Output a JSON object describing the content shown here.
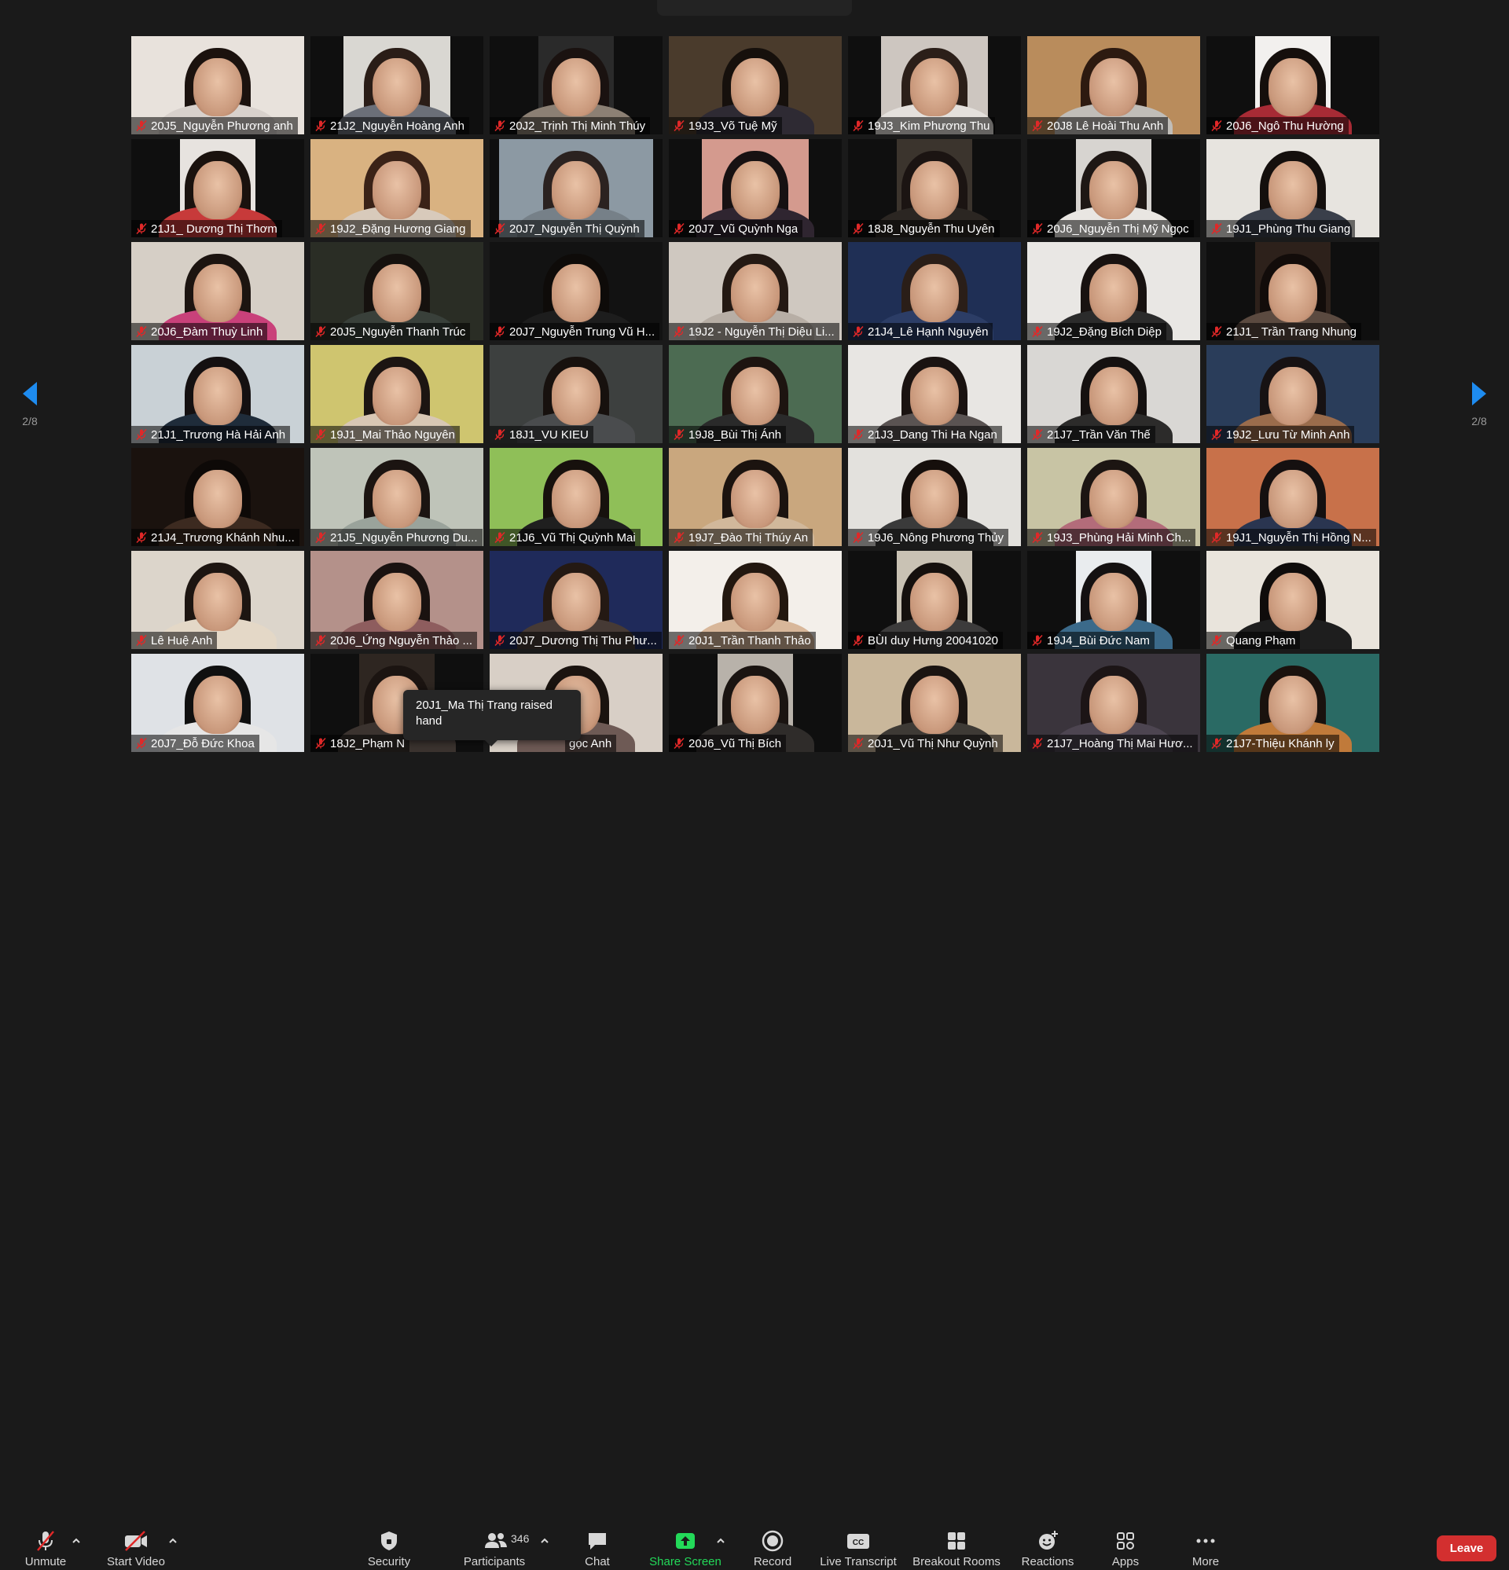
{
  "navigation": {
    "page_left": "2/8",
    "page_right": "2/8"
  },
  "participants": [
    {
      "name": "20J5_Nguyễn Phương anh",
      "bg": "#e8e2dc",
      "hair": "#1b120e",
      "shirt": "#d8d1cc",
      "fit": "full"
    },
    {
      "name": "21J2_Nguyễn Hoàng Anh",
      "bg": "#d9d7d2",
      "hair": "#2a1d17",
      "shirt": "#6b6f78",
      "fit": "mid"
    },
    {
      "name": "20J2_Trịnh Thị Minh Thúy",
      "bg": "#2a2a2a",
      "hair": "#1a1210",
      "shirt": "#8c8074",
      "fit": "narrow"
    },
    {
      "name": "19J3_Võ Tuệ Mỹ",
      "bg": "#4a3b2c",
      "hair": "#16100c",
      "shirt": "#2e2a33",
      "fit": "full"
    },
    {
      "name": "19J3_Kim Phương Thu",
      "bg": "#cdc6c0",
      "hair": "#2b1f19",
      "shirt": "#e4e0dc",
      "fit": "mid"
    },
    {
      "name": "20J8 Lê Hoài Thu Anh",
      "bg": "#b98c5c",
      "hair": "#2d1a10",
      "shirt": "#c0bdb8",
      "fit": "full"
    },
    {
      "name": "20J6_Ngô Thu Hường",
      "bg": "#f2f0ee",
      "hair": "#150f0c",
      "shirt": "#a72b35",
      "fit": "narrow"
    },
    {
      "name": "21J1_ Dương Thị Thơm",
      "bg": "#e7e3df",
      "hair": "#1a120e",
      "shirt": "#c73a3a",
      "fit": "narrow"
    },
    {
      "name": "19J2_Đặng Hương Giang",
      "bg": "#d9b281",
      "hair": "#3a2217",
      "shirt": "#d8cabb",
      "fit": "full"
    },
    {
      "name": "20J7_Nguyễn Thị Quỳnh",
      "bg": "#8c99a3",
      "hair": "#2b2220",
      "shirt": "#768088",
      "fit": "wide"
    },
    {
      "name": "20J7_Vũ Quỳnh Nga",
      "bg": "#d49a8e",
      "hair": "#171112",
      "shirt": "#2f2530",
      "fit": "mid"
    },
    {
      "name": "18J8_Nguyễn Thu Uyên",
      "bg": "#3b342d",
      "hair": "#1b1412",
      "shirt": "#2b2622",
      "fit": "narrow"
    },
    {
      "name": "20J6_Nguyễn Thị Mỹ Ngọc",
      "bg": "#d7d4d0",
      "hair": "#1e1714",
      "shirt": "#e9e6e2",
      "fit": "narrow"
    },
    {
      "name": "19J1_Phùng Thu Giang",
      "bg": "#e7e4df",
      "hair": "#140f0d",
      "shirt": "#3a3f4a",
      "fit": "full"
    },
    {
      "name": "20J6_Đàm Thuỳ Linh",
      "bg": "#d6cfc6",
      "hair": "#1c1410",
      "shirt": "#c9417a",
      "fit": "full"
    },
    {
      "name": "20J5_Nguyễn Thanh Trúc",
      "bg": "#2a2d25",
      "hair": "#15110e",
      "shirt": "#39403a",
      "fit": "full"
    },
    {
      "name": "20J7_Nguyễn Trung Vũ H...",
      "bg": "#121212",
      "hair": "#0e0b09",
      "shirt": "#1d1d1d",
      "fit": "full"
    },
    {
      "name": "19J2 - Nguyễn Thị Diệu Li...",
      "bg": "#cfc8c0",
      "hair": "#241913",
      "shirt": "#b7aea5",
      "fit": "full"
    },
    {
      "name": "21J4_Lê Hạnh Nguyên",
      "bg": "#1f2f55",
      "hair": "#2a1e18",
      "shirt": "#2c3d66",
      "fit": "full"
    },
    {
      "name": "19J2_Đặng Bích Diệp",
      "bg": "#e9e7e4",
      "hair": "#181210",
      "shirt": "#2b2b2b",
      "fit": "full"
    },
    {
      "name": "21J1_ Trần Trang Nhung",
      "bg": "#2d211b",
      "hair": "#120c0a",
      "shirt": "#5b4a40",
      "fit": "narrow"
    },
    {
      "name": "21J1_Trương Hà Hải Anh",
      "bg": "#c9d1d6",
      "hair": "#141011",
      "shirt": "#1f2c3a",
      "fit": "full"
    },
    {
      "name": "19J1_Mai Thảo Nguyên",
      "bg": "#cfc56f",
      "hair": "#1c1512",
      "shirt": "#d8c7b4",
      "fit": "full"
    },
    {
      "name": "18J1_VU KIEU",
      "bg": "#3d403f",
      "hair": "#17110e",
      "shirt": "#4a4c4e",
      "fit": "full"
    },
    {
      "name": "19J8_Bùi Thị Ánh",
      "bg": "#4c6b52",
      "hair": "#1d1410",
      "shirt": "#2a2a2a",
      "fit": "full"
    },
    {
      "name": "21J3_Dang Thi Ha Ngan",
      "bg": "#e8e6e3",
      "hair": "#1a1311",
      "shirt": "#5a5352",
      "fit": "full"
    },
    {
      "name": "21J7_Trần Văn Thế",
      "bg": "#d9d7d4",
      "hair": "#151110",
      "shirt": "#2c2b2a",
      "fit": "full"
    },
    {
      "name": "19J2_Lưu Từ Minh Anh",
      "bg": "#2a3d5a",
      "hair": "#171213",
      "shirt": "#9a6c4c",
      "fit": "full"
    },
    {
      "name": "21J4_Trương Khánh Nhu...",
      "bg": "#1a120e",
      "hair": "#0d0907",
      "shirt": "#3c2a20",
      "fit": "full"
    },
    {
      "name": "21J5_Nguyễn Phương Du...",
      "bg": "#bfc4b9",
      "hair": "#1b1411",
      "shirt": "#9aa39b",
      "fit": "full"
    },
    {
      "name": "21J6_Vũ Thị Quỳnh Mai",
      "bg": "#8fbf58",
      "hair": "#17110d",
      "shirt": "#1f1f1f",
      "fit": "full"
    },
    {
      "name": "19J7_Đào Thị Thúy An",
      "bg": "#c9a77e",
      "hair": "#1b130f",
      "shirt": "#d1b89b",
      "fit": "full"
    },
    {
      "name": "19J6_Nông Phương Thủy",
      "bg": "#e3e1dd",
      "hair": "#160f0c",
      "shirt": "#3a3a3a",
      "fit": "full"
    },
    {
      "name": "19J3_Phùng Hải Minh Ch...",
      "bg": "#c8c4a4",
      "hair": "#1c1512",
      "shirt": "#b36c7a",
      "fit": "full"
    },
    {
      "name": "19J1_Nguyễn Thị Hồng N...",
      "bg": "#c8714a",
      "hair": "#151010",
      "shirt": "#2a3550",
      "fit": "full"
    },
    {
      "name": "Lê Huệ Anh",
      "bg": "#dcd5cb",
      "hair": "#1d1511",
      "shirt": "#e4d8c7",
      "fit": "full"
    },
    {
      "name": "20J6_Ứng Nguyễn Thảo ...",
      "bg": "#b4918a",
      "hair": "#1a1210",
      "shirt": "#8e5d5e",
      "fit": "full"
    },
    {
      "name": "20J7_Dương Thị Thu Phư...",
      "bg": "#1f2a5a",
      "hair": "#241913",
      "shirt": "#463a35",
      "fit": "full"
    },
    {
      "name": "20J1_Trần Thanh Thảo",
      "bg": "#f3efea",
      "hair": "#22170f",
      "shirt": "#d8b79a",
      "fit": "full"
    },
    {
      "name": "BÙI duy Hưng 20041020",
      "bg": "#c9c2b4",
      "hair": "#15100d",
      "shirt": "#3c3b3b",
      "fit": "narrow"
    },
    {
      "name": "19J4_Bùi Đức Nam",
      "bg": "#e9ecee",
      "hair": "#141111",
      "shirt": "#3b6a8a",
      "fit": "narrow"
    },
    {
      "name": "Quang Phạm",
      "bg": "#e9e4dc",
      "hair": "#0f0c0b",
      "shirt": "#1e1e1e",
      "fit": "full"
    },
    {
      "name": "20J7_Đỗ Đức Khoa",
      "bg": "#dfe2e6",
      "hair": "#101010",
      "shirt": "#e6e6e6",
      "fit": "full"
    },
    {
      "name": "18J2_Phạm N",
      "bg": "#2e2621",
      "hair": "#1b1411",
      "shirt": "#3b332f",
      "fit": "narrow"
    },
    {
      "name": "20J1_Ma Thị Trang",
      "label_suffix": "gọc Anh",
      "bg": "#d8cfc6",
      "hair": "#1a130f",
      "shirt": "#6e5a55",
      "fit": "full"
    },
    {
      "name": "20J6_Vũ Thị Bích",
      "bg": "#b8b2aa",
      "hair": "#1a1411",
      "shirt": "#2f2c2a",
      "fit": "narrow"
    },
    {
      "name": "20J1_Vũ Thị Như Quỳnh",
      "bg": "#c9b79b",
      "hair": "#1a1411",
      "shirt": "#3e3a35",
      "fit": "full"
    },
    {
      "name": "21J7_Hoàng Thị Mai Hươ...",
      "bg": "#3a343c",
      "hair": "#1c1516",
      "shirt": "#4d4551",
      "fit": "full"
    },
    {
      "name": "21J7-Thiệu Khánh ly",
      "bg": "#2a6a64",
      "hair": "#1a120e",
      "shirt": "#c07a3a",
      "fit": "full"
    }
  ],
  "raise_hand_toast": {
    "text": "20J1_Ma Thị Trang raised hand"
  },
  "toolbar": {
    "unmute": "Unmute",
    "start_video": "Start Video",
    "security": "Security",
    "participants": "Participants",
    "participant_count": "346",
    "chat": "Chat",
    "share_screen": "Share Screen",
    "record": "Record",
    "live_transcript": "Live Transcript",
    "breakout_rooms": "Breakout Rooms",
    "reactions": "Reactions",
    "apps": "Apps",
    "more": "More",
    "leave": "Leave"
  },
  "colors": {
    "accent": "#0e72ed",
    "share": "#23d959",
    "leave": "#d32f2f",
    "muted": "#e02828"
  }
}
